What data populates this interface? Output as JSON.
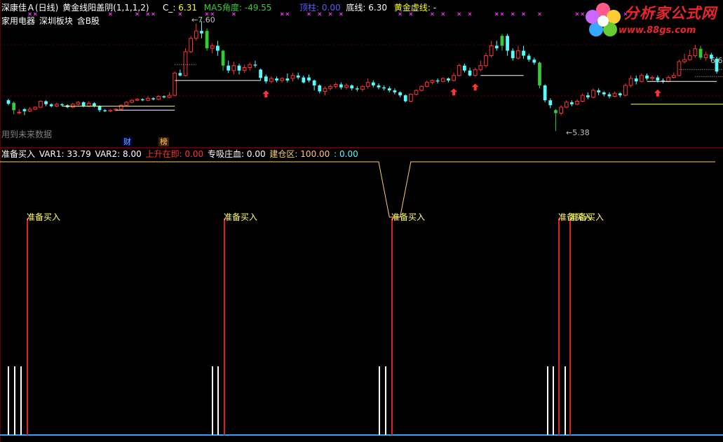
{
  "header": {
    "stock_name": "深康佳Ａ(日线)",
    "indicator_name": "黄金线阳盖阴(1,1,1,2)",
    "c_label": "C_:",
    "c_value": "6.31",
    "ma5_label": "MA5角度:",
    "ma5_value": "-49.55",
    "dingzhu_label": "顶柱:",
    "dingzhu_value": "0.00",
    "dixian_label": "底线:",
    "dixian_value": "6.30",
    "huangjin_label": "黄金虚线:",
    "huangjin_value": "-"
  },
  "subheader": {
    "sector1": "家用电器",
    "sector2": "深圳板块",
    "sector3": "含B股"
  },
  "main_chart": {
    "future_data_note": "用到未来数据",
    "price_high_label": "7.60",
    "price_low_label": "5.38",
    "price_right_label": "6.6",
    "badge_cai": "财",
    "badge_bang": "榜"
  },
  "lower_panel": {
    "label_zhunbei": "准备买入",
    "var1_label": "VAR1:",
    "var1_value": "33.79",
    "var2_label": "VAR2:",
    "var2_value": "8.00",
    "shangsheng_label": "上升在即:",
    "shangsheng_value": "0.00",
    "zhuanxi_label": "专吸庄血:",
    "zhuanxi_value": "0.00",
    "jiancang_label": "建仓区:",
    "jiancang_value": "100.00",
    "extra_label": ":",
    "extra_value": "0.00",
    "signal_label_1": "准备买入",
    "signal_label_2": "准备买入",
    "signal_label_3": "准备买入",
    "signal_label_4": "准备买入",
    "signal_label_5": "准备买入"
  },
  "watermark": {
    "title": "分析家公式网",
    "url": "www.88gs.com"
  },
  "colors": {
    "up": "#ff3333",
    "down": "#54ffff",
    "green": "#33cc33",
    "yellow": "#ffff00",
    "magenta": "#ff33ff",
    "blue_text": "#5b5bff",
    "label_gray": "#c0c0c0",
    "border_red": "#b40000"
  },
  "chart_data": {
    "type": "candlestick",
    "price_high": 7.6,
    "price_low": 5.38,
    "candles": [
      {
        "o": 6.0,
        "c": 5.93,
        "h": 6.03,
        "l": 5.9,
        "g": false
      },
      {
        "o": 5.95,
        "c": 5.8,
        "h": 5.97,
        "l": 5.72,
        "g": true
      },
      {
        "o": 5.75,
        "c": 5.76,
        "h": 5.82,
        "l": 5.72,
        "g": false
      },
      {
        "o": 5.82,
        "c": 5.78,
        "h": 5.84,
        "l": 5.7,
        "g": false
      },
      {
        "o": 5.78,
        "c": 5.82,
        "h": 5.86,
        "l": 5.76,
        "g": false
      },
      {
        "o": 5.82,
        "c": 5.86,
        "h": 5.88,
        "l": 5.8,
        "g": false
      },
      {
        "o": 5.86,
        "c": 5.98,
        "h": 6.0,
        "l": 5.84,
        "g": false
      },
      {
        "o": 5.98,
        "c": 5.92,
        "h": 6.0,
        "l": 5.88,
        "g": false
      },
      {
        "o": 5.92,
        "c": 5.88,
        "h": 5.94,
        "l": 5.86,
        "g": false
      },
      {
        "o": 5.88,
        "c": 5.92,
        "h": 5.95,
        "l": 5.86,
        "g": false
      },
      {
        "o": 5.92,
        "c": 5.9,
        "h": 5.94,
        "l": 5.88,
        "g": false
      },
      {
        "o": 5.9,
        "c": 5.86,
        "h": 5.92,
        "l": 5.84,
        "g": false
      },
      {
        "o": 5.86,
        "c": 5.92,
        "h": 5.95,
        "l": 5.84,
        "g": false
      },
      {
        "o": 5.92,
        "c": 5.96,
        "h": 5.98,
        "l": 5.9,
        "g": false
      },
      {
        "o": 5.96,
        "c": 5.88,
        "h": 5.98,
        "l": 5.86,
        "g": false
      },
      {
        "o": 5.88,
        "c": 5.94,
        "h": 5.98,
        "l": 5.86,
        "g": false
      },
      {
        "o": 5.94,
        "c": 5.88,
        "h": 5.96,
        "l": 5.86,
        "g": false
      },
      {
        "o": 5.88,
        "c": 5.8,
        "h": 5.9,
        "l": 5.76,
        "g": false
      },
      {
        "o": 5.8,
        "c": 5.78,
        "h": 5.82,
        "l": 5.76,
        "g": false
      },
      {
        "o": 5.78,
        "c": 5.8,
        "h": 5.82,
        "l": 5.76,
        "g": false
      },
      {
        "o": 5.8,
        "c": 5.82,
        "h": 5.84,
        "l": 5.78,
        "g": false
      },
      {
        "o": 5.82,
        "c": 5.9,
        "h": 5.92,
        "l": 5.8,
        "g": false
      },
      {
        "o": 5.9,
        "c": 5.96,
        "h": 5.98,
        "l": 5.88,
        "g": false
      },
      {
        "o": 5.96,
        "c": 6.0,
        "h": 6.02,
        "l": 5.94,
        "g": false
      },
      {
        "o": 6.0,
        "c": 6.02,
        "h": 6.04,
        "l": 5.98,
        "g": false
      },
      {
        "o": 6.02,
        "c": 6.0,
        "h": 6.04,
        "l": 5.98,
        "g": false
      },
      {
        "o": 6.0,
        "c": 6.04,
        "h": 6.08,
        "l": 5.98,
        "g": false
      },
      {
        "o": 6.04,
        "c": 6.02,
        "h": 6.06,
        "l": 6.0,
        "g": false
      },
      {
        "o": 6.02,
        "c": 6.08,
        "h": 6.1,
        "l": 6.0,
        "g": false
      },
      {
        "o": 6.08,
        "c": 6.06,
        "h": 6.1,
        "l": 6.04,
        "g": false
      },
      {
        "o": 6.06,
        "c": 6.1,
        "h": 6.16,
        "l": 6.04,
        "g": false
      },
      {
        "o": 6.1,
        "c": 6.55,
        "h": 6.58,
        "l": 6.08,
        "g": false
      },
      {
        "o": 6.55,
        "c": 6.5,
        "h": 6.62,
        "l": 6.48,
        "g": false
      },
      {
        "o": 6.5,
        "c": 6.98,
        "h": 7.05,
        "l": 6.48,
        "g": false
      },
      {
        "o": 6.98,
        "c": 7.25,
        "h": 7.3,
        "l": 6.95,
        "g": false
      },
      {
        "o": 7.25,
        "c": 7.4,
        "h": 7.55,
        "l": 7.2,
        "g": false
      },
      {
        "o": 7.4,
        "c": 7.35,
        "h": 7.6,
        "l": 7.25,
        "g": false
      },
      {
        "o": 7.4,
        "c": 7.05,
        "h": 7.45,
        "l": 7.0,
        "g": true
      },
      {
        "o": 7.05,
        "c": 7.1,
        "h": 7.15,
        "l": 6.95,
        "g": false
      },
      {
        "o": 7.1,
        "c": 7.0,
        "h": 7.2,
        "l": 6.9,
        "g": false
      },
      {
        "o": 7.0,
        "c": 6.7,
        "h": 7.02,
        "l": 6.6,
        "g": true
      },
      {
        "o": 6.7,
        "c": 6.6,
        "h": 6.8,
        "l": 6.55,
        "g": false
      },
      {
        "o": 6.6,
        "c": 6.7,
        "h": 6.78,
        "l": 6.52,
        "g": false
      },
      {
        "o": 6.7,
        "c": 6.6,
        "h": 6.74,
        "l": 6.52,
        "g": false
      },
      {
        "o": 6.6,
        "c": 6.66,
        "h": 6.72,
        "l": 6.55,
        "g": false
      },
      {
        "o": 6.66,
        "c": 6.72,
        "h": 6.76,
        "l": 6.6,
        "g": false
      },
      {
        "o": 6.72,
        "c": 6.7,
        "h": 6.8,
        "l": 6.66,
        "g": false
      },
      {
        "o": 6.62,
        "c": 6.45,
        "h": 6.64,
        "l": 6.4,
        "g": false
      },
      {
        "o": 6.48,
        "c": 6.38,
        "h": 6.52,
        "l": 6.34,
        "g": false
      },
      {
        "o": 6.38,
        "c": 6.44,
        "h": 6.48,
        "l": 6.34,
        "g": false
      },
      {
        "o": 6.44,
        "c": 6.4,
        "h": 6.48,
        "l": 6.36,
        "g": false
      },
      {
        "o": 6.4,
        "c": 6.44,
        "h": 6.46,
        "l": 6.36,
        "g": false
      },
      {
        "o": 6.44,
        "c": 6.4,
        "h": 6.54,
        "l": 6.36,
        "g": false
      },
      {
        "o": 6.44,
        "c": 6.5,
        "h": 6.56,
        "l": 6.38,
        "g": false
      },
      {
        "o": 6.5,
        "c": 6.46,
        "h": 6.56,
        "l": 6.42,
        "g": false
      },
      {
        "o": 6.46,
        "c": 6.36,
        "h": 6.5,
        "l": 6.34,
        "g": false
      },
      {
        "o": 6.46,
        "c": 6.4,
        "h": 6.52,
        "l": 6.36,
        "g": false
      },
      {
        "o": 6.4,
        "c": 6.3,
        "h": 6.42,
        "l": 6.2,
        "g": false
      },
      {
        "o": 6.3,
        "c": 6.18,
        "h": 6.32,
        "l": 6.14,
        "g": false
      },
      {
        "o": 6.18,
        "c": 6.24,
        "h": 6.28,
        "l": 6.1,
        "g": false
      },
      {
        "o": 6.24,
        "c": 6.28,
        "h": 6.32,
        "l": 6.2,
        "g": false
      },
      {
        "o": 6.28,
        "c": 6.32,
        "h": 6.36,
        "l": 6.24,
        "g": false
      },
      {
        "o": 6.32,
        "c": 6.26,
        "h": 6.36,
        "l": 6.22,
        "g": false
      },
      {
        "o": 6.26,
        "c": 6.3,
        "h": 6.34,
        "l": 6.22,
        "g": false
      },
      {
        "o": 6.3,
        "c": 6.24,
        "h": 6.32,
        "l": 6.2,
        "g": false
      },
      {
        "o": 6.24,
        "c": 6.22,
        "h": 6.28,
        "l": 6.18,
        "g": false
      },
      {
        "o": 6.22,
        "c": 6.28,
        "h": 6.3,
        "l": 6.18,
        "g": false
      },
      {
        "o": 6.28,
        "c": 6.36,
        "h": 6.44,
        "l": 6.24,
        "g": false
      },
      {
        "o": 6.36,
        "c": 6.3,
        "h": 6.4,
        "l": 6.26,
        "g": false
      },
      {
        "o": 6.3,
        "c": 6.26,
        "h": 6.34,
        "l": 6.22,
        "g": false
      },
      {
        "o": 6.26,
        "c": 6.24,
        "h": 6.3,
        "l": 6.2,
        "g": false
      },
      {
        "o": 6.24,
        "c": 6.2,
        "h": 6.28,
        "l": 6.16,
        "g": false
      },
      {
        "o": 6.2,
        "c": 6.16,
        "h": 6.24,
        "l": 6.12,
        "g": false
      },
      {
        "o": 6.16,
        "c": 6.1,
        "h": 6.18,
        "l": 6.06,
        "g": false
      },
      {
        "o": 6.1,
        "c": 5.98,
        "h": 6.12,
        "l": 5.96,
        "g": false
      },
      {
        "o": 5.98,
        "c": 6.12,
        "h": 6.14,
        "l": 5.96,
        "g": false
      },
      {
        "o": 6.12,
        "c": 6.2,
        "h": 6.22,
        "l": 6.1,
        "g": false
      },
      {
        "o": 6.2,
        "c": 6.28,
        "h": 6.3,
        "l": 6.18,
        "g": false
      },
      {
        "o": 6.28,
        "c": 6.36,
        "h": 6.4,
        "l": 6.26,
        "g": false
      },
      {
        "o": 6.36,
        "c": 6.4,
        "h": 6.42,
        "l": 6.32,
        "g": false
      },
      {
        "o": 6.4,
        "c": 6.38,
        "h": 6.44,
        "l": 6.34,
        "g": false
      },
      {
        "o": 6.38,
        "c": 6.44,
        "h": 6.46,
        "l": 6.36,
        "g": false
      },
      {
        "o": 6.44,
        "c": 6.4,
        "h": 6.46,
        "l": 6.36,
        "g": false
      },
      {
        "o": 6.4,
        "c": 6.5,
        "h": 6.56,
        "l": 6.38,
        "g": false
      },
      {
        "o": 6.5,
        "c": 6.7,
        "h": 6.74,
        "l": 6.48,
        "g": false
      },
      {
        "o": 6.7,
        "c": 6.6,
        "h": 6.74,
        "l": 6.56,
        "g": false
      },
      {
        "o": 6.6,
        "c": 6.5,
        "h": 6.66,
        "l": 6.48,
        "g": false
      },
      {
        "o": 6.5,
        "c": 6.62,
        "h": 6.66,
        "l": 6.48,
        "g": false
      },
      {
        "o": 6.62,
        "c": 6.7,
        "h": 6.8,
        "l": 6.58,
        "g": false
      },
      {
        "o": 6.7,
        "c": 6.9,
        "h": 6.96,
        "l": 6.66,
        "g": false
      },
      {
        "o": 6.9,
        "c": 7.1,
        "h": 7.2,
        "l": 6.86,
        "g": false
      },
      {
        "o": 7.1,
        "c": 7.05,
        "h": 7.2,
        "l": 7.0,
        "g": false
      },
      {
        "o": 7.1,
        "c": 7.3,
        "h": 7.34,
        "l": 7.0,
        "g": true
      },
      {
        "o": 7.3,
        "c": 7.0,
        "h": 7.34,
        "l": 6.9,
        "g": false
      },
      {
        "o": 7.0,
        "c": 6.85,
        "h": 7.05,
        "l": 6.8,
        "g": false
      },
      {
        "o": 6.85,
        "c": 7.0,
        "h": 7.1,
        "l": 6.82,
        "g": false
      },
      {
        "o": 7.0,
        "c": 6.9,
        "h": 7.1,
        "l": 6.84,
        "g": false
      },
      {
        "o": 6.9,
        "c": 6.82,
        "h": 6.94,
        "l": 6.78,
        "g": false
      },
      {
        "o": 6.82,
        "c": 6.76,
        "h": 6.86,
        "l": 6.72,
        "g": false
      },
      {
        "o": 6.76,
        "c": 6.3,
        "h": 6.78,
        "l": 6.24,
        "g": true
      },
      {
        "o": 6.3,
        "c": 6.0,
        "h": 6.32,
        "l": 5.96,
        "g": false
      },
      {
        "o": 6.0,
        "c": 5.9,
        "h": 6.04,
        "l": 5.84,
        "g": false
      },
      {
        "o": 5.8,
        "c": 5.74,
        "h": 5.82,
        "l": 5.38,
        "g": true
      },
      {
        "o": 5.74,
        "c": 5.86,
        "h": 5.9,
        "l": 5.7,
        "g": false
      },
      {
        "o": 5.86,
        "c": 5.96,
        "h": 6.0,
        "l": 5.84,
        "g": false
      },
      {
        "o": 5.96,
        "c": 5.92,
        "h": 6.0,
        "l": 5.88,
        "g": false
      },
      {
        "o": 5.92,
        "c": 5.98,
        "h": 6.02,
        "l": 5.9,
        "g": false
      },
      {
        "o": 5.98,
        "c": 6.1,
        "h": 6.14,
        "l": 5.96,
        "g": false
      },
      {
        "o": 6.1,
        "c": 6.06,
        "h": 6.16,
        "l": 6.02,
        "g": false
      },
      {
        "o": 6.06,
        "c": 6.2,
        "h": 6.24,
        "l": 6.04,
        "g": false
      },
      {
        "o": 6.2,
        "c": 6.16,
        "h": 6.24,
        "l": 6.1,
        "g": false
      },
      {
        "o": 6.16,
        "c": 6.12,
        "h": 6.18,
        "l": 6.08,
        "g": false
      },
      {
        "o": 6.12,
        "c": 6.08,
        "h": 6.16,
        "l": 6.04,
        "g": false
      },
      {
        "o": 6.08,
        "c": 6.14,
        "h": 6.18,
        "l": 6.06,
        "g": false
      },
      {
        "o": 6.14,
        "c": 6.1,
        "h": 6.16,
        "l": 6.06,
        "g": false
      },
      {
        "o": 6.1,
        "c": 6.3,
        "h": 6.34,
        "l": 6.08,
        "g": false
      },
      {
        "o": 6.3,
        "c": 6.44,
        "h": 6.5,
        "l": 6.26,
        "g": false
      },
      {
        "o": 6.44,
        "c": 6.38,
        "h": 6.5,
        "l": 6.32,
        "g": false
      },
      {
        "o": 6.38,
        "c": 6.5,
        "h": 6.54,
        "l": 6.36,
        "g": false
      },
      {
        "o": 6.5,
        "c": 6.44,
        "h": 6.54,
        "l": 6.4,
        "g": false
      },
      {
        "o": 6.44,
        "c": 6.46,
        "h": 6.5,
        "l": 6.4,
        "g": false
      },
      {
        "o": 6.46,
        "c": 6.4,
        "h": 6.5,
        "l": 6.36,
        "g": false
      },
      {
        "o": 6.4,
        "c": 6.38,
        "h": 6.44,
        "l": 6.34,
        "g": false
      },
      {
        "o": 6.38,
        "c": 6.46,
        "h": 6.5,
        "l": 6.36,
        "g": false
      },
      {
        "o": 6.46,
        "c": 6.5,
        "h": 6.56,
        "l": 6.44,
        "g": false
      },
      {
        "o": 6.5,
        "c": 6.78,
        "h": 6.82,
        "l": 6.48,
        "g": false
      },
      {
        "o": 6.78,
        "c": 6.82,
        "h": 6.94,
        "l": 6.74,
        "g": false
      },
      {
        "o": 6.82,
        "c": 6.9,
        "h": 7.02,
        "l": 6.8,
        "g": false
      },
      {
        "o": 6.9,
        "c": 7.04,
        "h": 7.12,
        "l": 6.86,
        "g": false
      },
      {
        "o": 7.04,
        "c": 6.86,
        "h": 7.1,
        "l": 6.82,
        "g": true
      },
      {
        "o": 6.86,
        "c": 6.92,
        "h": 6.98,
        "l": 6.8,
        "g": false
      },
      {
        "o": 6.92,
        "c": 6.84,
        "h": 6.96,
        "l": 6.8,
        "g": false
      },
      {
        "o": 6.84,
        "c": 6.58,
        "h": 6.88,
        "l": 6.54,
        "g": false
      }
    ],
    "buy_arrows": [
      48,
      83,
      87,
      121
    ],
    "cross_marks": [
      4,
      5,
      19,
      24,
      26,
      27,
      32,
      37,
      38,
      42,
      51,
      52,
      56,
      58,
      60,
      62,
      73,
      75,
      79,
      81,
      84,
      86,
      91,
      92,
      94,
      96,
      99,
      106,
      107,
      110,
      111,
      115,
      117,
      120
    ],
    "lower_red_bars": [
      9,
      100,
      175,
      253,
      308,
      314
    ],
    "lower_white_bars": [
      3,
      6,
      9,
      94,
      97,
      171,
      174,
      244,
      247,
      252
    ]
  }
}
